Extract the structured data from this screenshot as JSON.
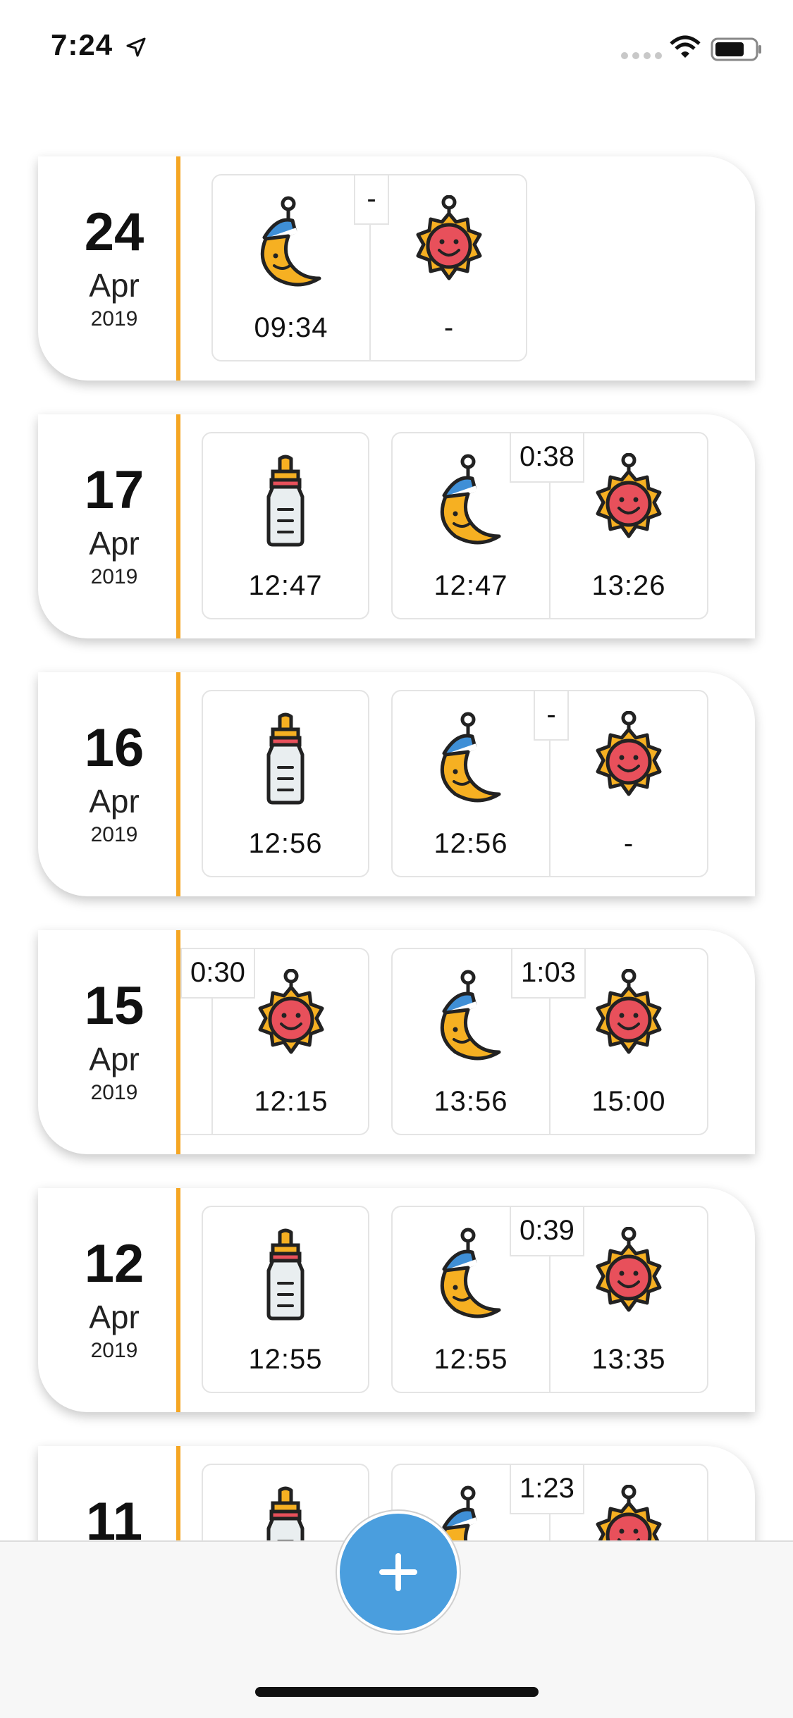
{
  "status_bar": {
    "time": "7:24"
  },
  "colors": {
    "accent_line": "#f5a623",
    "fab": "#4a9ede"
  },
  "days": [
    {
      "day": "24",
      "month": "Apr",
      "year": "2019",
      "entries": [
        {
          "type": "sleep-session",
          "duration": "-",
          "start": "09:34",
          "end": "-"
        }
      ]
    },
    {
      "day": "17",
      "month": "Apr",
      "year": "2019",
      "entries": [
        {
          "type": "bottle",
          "time": "12:47"
        },
        {
          "type": "sleep-session",
          "duration": "0:38",
          "start": "12:47",
          "end": "13:26"
        }
      ]
    },
    {
      "day": "16",
      "month": "Apr",
      "year": "2019",
      "entries": [
        {
          "type": "bottle",
          "time": "12:56"
        },
        {
          "type": "sleep-session",
          "duration": "-",
          "start": "12:56",
          "end": "-"
        }
      ]
    },
    {
      "day": "15",
      "month": "Apr",
      "year": "2019",
      "entries": [
        {
          "type": "wake-continued",
          "duration": "0:30",
          "end": "12:15"
        },
        {
          "type": "sleep-session",
          "duration": "1:03",
          "start": "13:56",
          "end": "15:00"
        }
      ]
    },
    {
      "day": "12",
      "month": "Apr",
      "year": "2019",
      "entries": [
        {
          "type": "bottle",
          "time": "12:55"
        },
        {
          "type": "sleep-session",
          "duration": "0:39",
          "start": "12:55",
          "end": "13:35"
        }
      ]
    },
    {
      "day": "11",
      "month": "Apr",
      "year": "2019",
      "entries": [
        {
          "type": "bottle",
          "time": ""
        },
        {
          "type": "sleep-session",
          "duration": "1:23",
          "start": "",
          "end": ""
        }
      ]
    }
  ],
  "fab": {
    "icon": "plus-icon"
  }
}
